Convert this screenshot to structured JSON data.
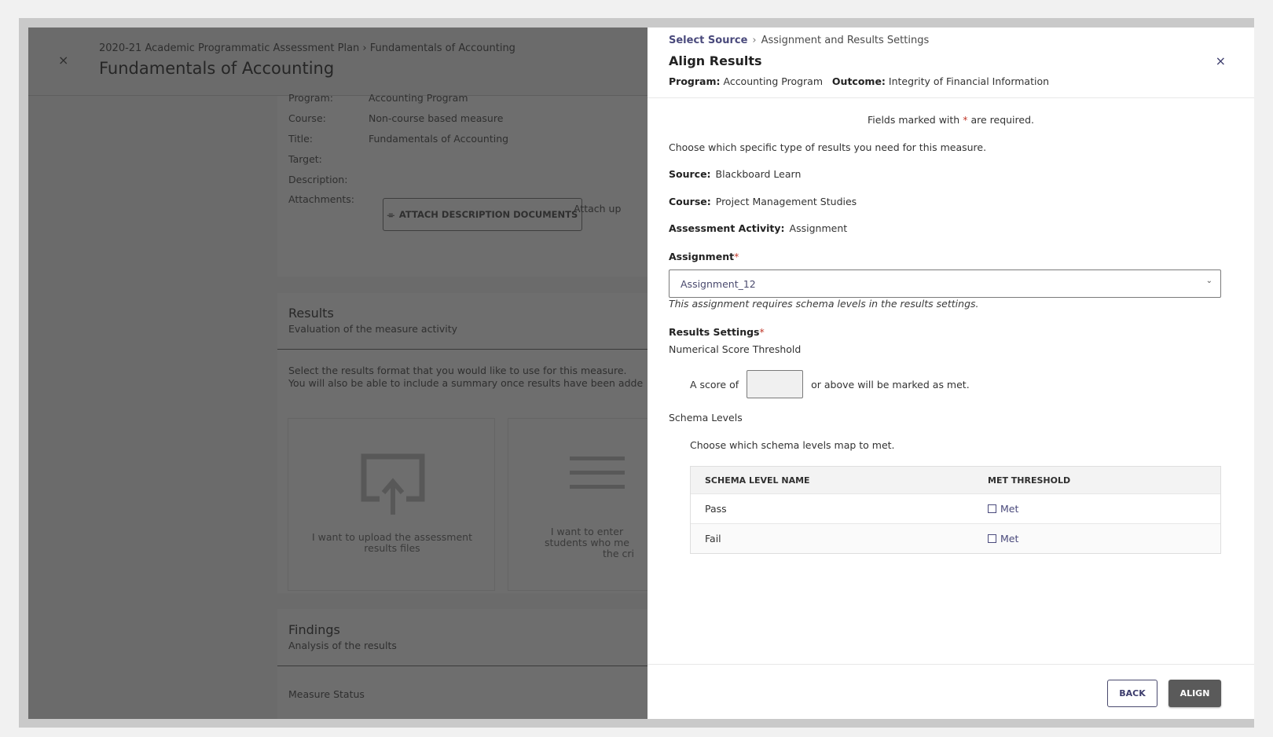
{
  "background_page": {
    "close_glyph": "×",
    "breadcrumb": "2020-21 Academic Programmatic Assessment Plan › Fundamentals of Accounting",
    "title": "Fundamentals of Accounting",
    "details": [
      {
        "label": "Program:",
        "value": "Accounting Program"
      },
      {
        "label": "Course:",
        "value": "Non-course based measure"
      },
      {
        "label": "Title:",
        "value": "Fundamentals of Accounting"
      },
      {
        "label": "Target:",
        "value": ""
      },
      {
        "label": "Description:",
        "value": ""
      },
      {
        "label": "Attachments:",
        "value": ""
      }
    ],
    "attach_button": "ATTACH DESCRIPTION DOCUMENTS",
    "attach_hint": "Attach up",
    "results": {
      "title": "Results",
      "subtitle": "Evaluation of the measure activity",
      "instruction_1": "Select the results format that you would like to use for this measure.",
      "instruction_2": "You will also be able to include a summary once results have been adde",
      "tile_upload": "I want to upload the assessment results files",
      "tile_enter_1": "I want to enter",
      "tile_enter_2": "students who me",
      "tile_enter_3": "the cri"
    },
    "findings": {
      "title": "Findings",
      "subtitle": "Analysis of the results",
      "measure_status": "Measure Status"
    }
  },
  "panel": {
    "breadcrumb": {
      "link": "Select Source",
      "separator": "›",
      "current": "Assignment and Results Settings"
    },
    "title": "Align Results",
    "close_glyph": "×",
    "program_label": "Program:",
    "program_value": "Accounting Program",
    "outcome_label": "Outcome:",
    "outcome_value": "Integrity of Financial Information",
    "required_note_pre": "Fields marked with",
    "required_star": "*",
    "required_note_post": "are required.",
    "intro": "Choose which specific type of results you need for this measure.",
    "source_label": "Source:",
    "source_value": "Blackboard Learn",
    "course_label": "Course:",
    "course_value": "Project Management Studies",
    "activity_label": "Assessment Activity:",
    "activity_value": "Assignment",
    "assignment_label": "Assignment",
    "assignment_value": "Assignment_12",
    "assignment_chevron": "⌄",
    "assignment_helper": "This assignment requires schema levels in the results settings.",
    "results_settings_label": "Results Settings",
    "threshold_type": "Numerical Score Threshold",
    "score_prefix": "A score of",
    "score_value": "",
    "score_suffix": "or above will be marked as met.",
    "schema_levels_label": "Schema Levels",
    "schema_instruction": "Choose which schema levels map to met.",
    "table": {
      "col_name": "SCHEMA LEVEL NAME",
      "col_threshold": "MET THRESHOLD",
      "rows": [
        {
          "name": "Pass",
          "met_label": "Met",
          "checked": false
        },
        {
          "name": "Fail",
          "met_label": "Met",
          "checked": false
        }
      ]
    },
    "back_button": "BACK",
    "align_button": "ALIGN"
  },
  "colors": {
    "accent": "#4a4a7c",
    "required": "#c0392b",
    "overlay": "#6b6b6b",
    "primary_button": "#5a5a5a"
  }
}
